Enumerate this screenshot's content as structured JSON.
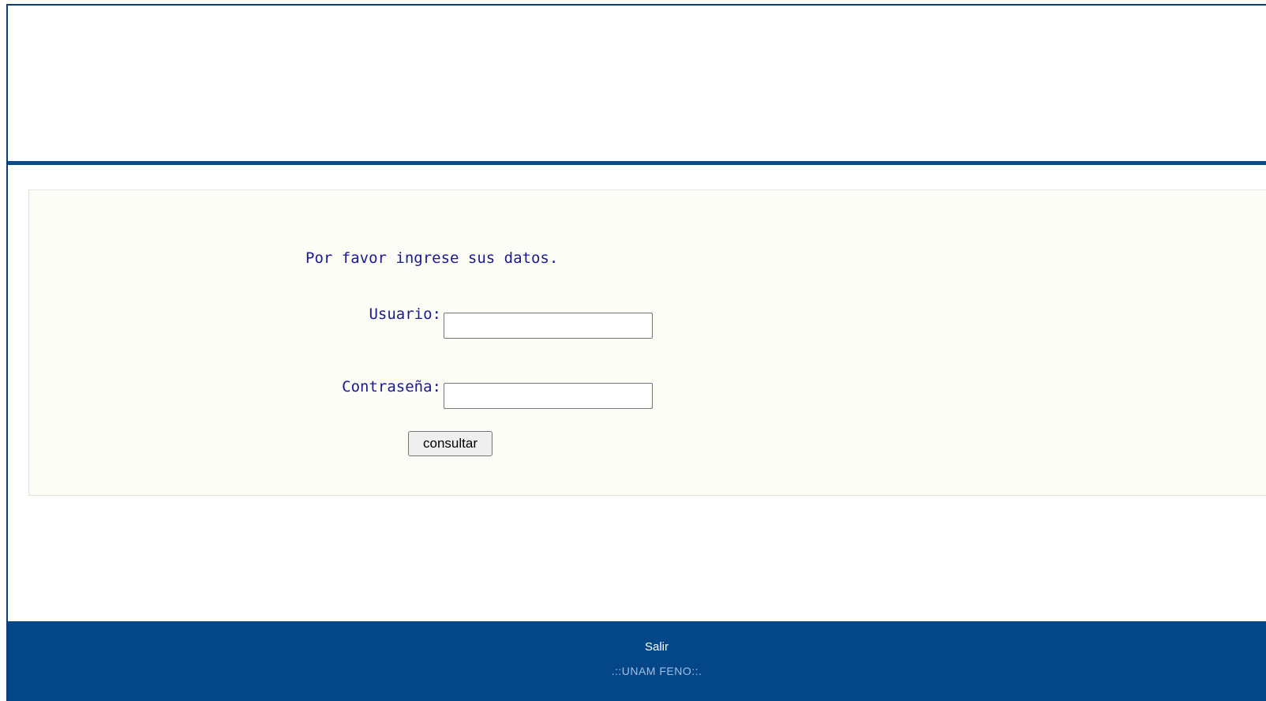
{
  "login": {
    "instruction": "Por favor ingrese sus datos.",
    "username_label": "Usuario:",
    "username_value": "",
    "password_label": "Contraseña:",
    "password_value": "",
    "submit_label": "consultar"
  },
  "footer": {
    "exit_link": "Salir",
    "brand": ".::UNAM FENO::."
  },
  "colors": {
    "primary_blue": "#034789",
    "label_text": "#1a1a8f",
    "panel_background": "#fdfdf7",
    "footer_brand_text": "#9fc0e8"
  }
}
